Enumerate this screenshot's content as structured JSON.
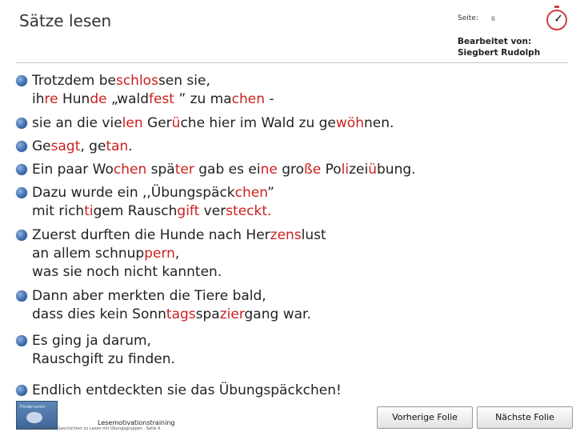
{
  "header": {
    "title": "Sätze lesen",
    "seite_label": "Seite:",
    "seite_number": "6",
    "author_line1": "Bearbeitet von:",
    "author_line2": "Siegbert Rudolph"
  },
  "bullets": [
    {
      "lines": [
        [
          {
            "t": "Trotzdem be"
          },
          {
            "t": "schlos",
            "h": true
          },
          {
            "t": "sen sie,"
          }
        ],
        [
          {
            "t": "ih"
          },
          {
            "t": "re",
            "h": true
          },
          {
            "t": " Hun"
          },
          {
            "t": "de",
            "h": true
          },
          {
            "t": " „wald"
          },
          {
            "t": "fest",
            "h": true
          },
          {
            "t": " ” zu ma"
          },
          {
            "t": "chen",
            "h": true
          },
          {
            "t": " -"
          }
        ]
      ]
    },
    {
      "lines": [
        [
          {
            "t": "sie an die vie"
          },
          {
            "t": "len",
            "h": true
          },
          {
            "t": " Ger"
          },
          {
            "t": "ü",
            "h": true
          },
          {
            "t": "che hier im Wald zu ge"
          },
          {
            "t": "wöh",
            "h": true
          },
          {
            "t": "nen."
          }
        ]
      ]
    },
    {
      "lines": [
        [
          {
            "t": "Ge"
          },
          {
            "t": "sagt",
            "h": true
          },
          {
            "t": ", ge"
          },
          {
            "t": "tan",
            "h": true
          },
          {
            "t": "."
          }
        ]
      ]
    },
    {
      "lines": [
        [
          {
            "t": "Ein paar Wo"
          },
          {
            "t": "chen",
            "h": true
          },
          {
            "t": " spä"
          },
          {
            "t": "ter",
            "h": true
          },
          {
            "t": " gab es ei"
          },
          {
            "t": "ne",
            "h": true
          },
          {
            "t": " gro"
          },
          {
            "t": "ße",
            "h": true
          },
          {
            "t": " Po"
          },
          {
            "t": "li",
            "h": true
          },
          {
            "t": "zei"
          },
          {
            "t": "ü",
            "h": true
          },
          {
            "t": "bung."
          }
        ]
      ]
    },
    {
      "lines": [
        [
          {
            "t": "Dazu wurde ein ,,Übungs"
          },
          {
            "t": "päck",
            "h": false
          },
          {
            "t": "chen",
            "h": true
          },
          {
            "t": "”"
          }
        ],
        [
          {
            "t": "mit rich"
          },
          {
            "t": "ti",
            "h": true
          },
          {
            "t": "gem Rausch"
          },
          {
            "t": "gift",
            "h": true
          },
          {
            "t": " ver"
          },
          {
            "t": "steckt.",
            "h": true
          }
        ]
      ]
    },
    {
      "lines": [
        [
          {
            "t": "Zuerst durften die Hunde nach Her"
          },
          {
            "t": "zens",
            "h": true
          },
          {
            "t": "lust"
          }
        ],
        [
          {
            "t": "an allem schnup"
          },
          {
            "t": "pern",
            "h": true
          },
          {
            "t": ","
          }
        ],
        [
          {
            "t": "was sie noch nicht kannten."
          }
        ]
      ]
    },
    {
      "lines": [
        [
          {
            "t": "Dann aber merkten die Tiere bald,"
          }
        ],
        [
          {
            "t": "dass dies kein Sonn"
          },
          {
            "t": "tags",
            "h": true
          },
          {
            "t": "spa"
          },
          {
            "t": "zier",
            "h": true
          },
          {
            "t": "gang war."
          }
        ]
      ]
    },
    {
      "lines": [
        [
          {
            "t": "Es ging ja darum,"
          }
        ],
        [
          {
            "t": "Rauschgift zu finden."
          }
        ]
      ]
    },
    {
      "lines": [
        [
          {
            "t": "Endlich entdeckten sie das Übungspäckchen!"
          }
        ]
      ]
    }
  ],
  "footer": {
    "logo_text": "Förderverein",
    "title": "Lesemotivationstraining",
    "subtitle": "Teil 1 · Sätze/Texte/Geschichten zu Lesen mit Übungsgruppen · Seite 4",
    "prev_label": "Vorherige Folie",
    "next_label": "Nächste Folie"
  },
  "colors": {
    "highlight": "#cc1f1f",
    "bullet": "#3f6fb4"
  }
}
